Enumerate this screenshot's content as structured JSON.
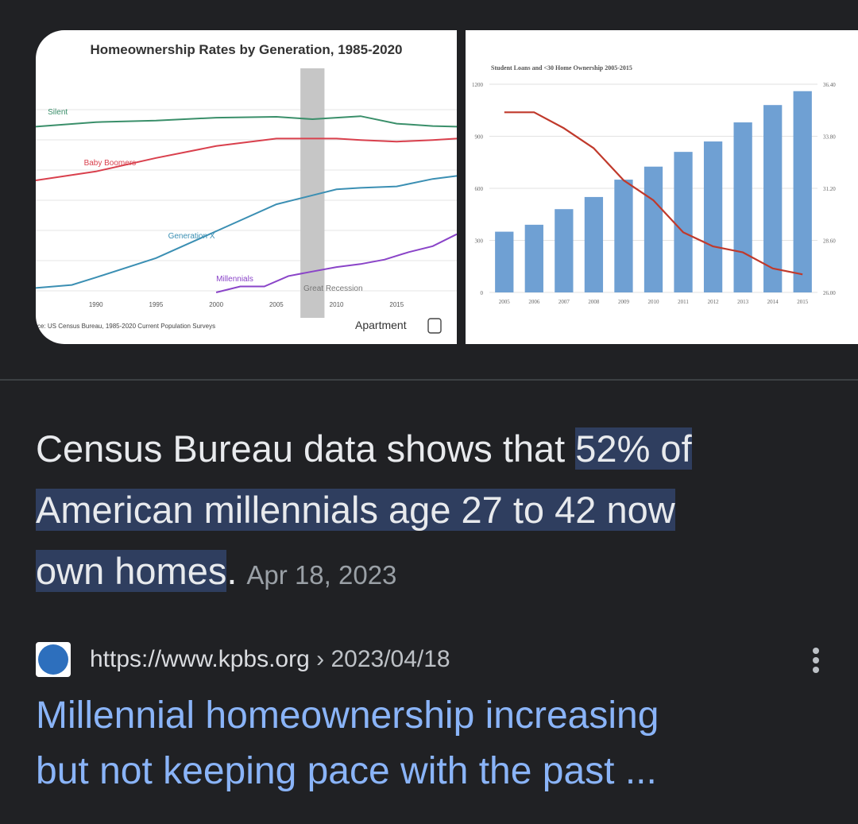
{
  "snippet": {
    "prefix": "Census Bureau data shows that ",
    "highlight_line1": "52% of",
    "highlight_line2": "American millennials age 27 to 42 now",
    "highlight_line3": "own homes",
    "suffix": ".",
    "date": "Apr 18, 2023"
  },
  "source": {
    "url": "https://www.kpbs.org",
    "separator": " › ",
    "path": "2023/04/18",
    "favicon_color": "#2d6fbd",
    "more_icon": "more-vert-icon"
  },
  "result": {
    "title_line1": "Millennial homeownership increasing",
    "title_line2": "but not keeping pace with the past ..."
  },
  "colors": {
    "background": "#202124",
    "link": "#8ab4f8",
    "highlight": "#2f3e5f",
    "muted": "#9aa0a6"
  },
  "chart_data": [
    {
      "type": "line",
      "title": "Homeownership Rates by Generation, 1985-2020",
      "x": [
        1985,
        1990,
        1995,
        2000,
        2005,
        2010,
        2015,
        2020
      ],
      "x_ticks": [
        "1990",
        "1995",
        "2000",
        "2005",
        "2010",
        "2015"
      ],
      "xlim": [
        1985,
        2020
      ],
      "series": [
        {
          "name": "Silent",
          "color": "#3a8f6a",
          "x": [
            1985,
            1990,
            1995,
            2000,
            2005,
            2008,
            2010,
            2012,
            2015,
            2018,
            2020
          ],
          "values": [
            79,
            80.5,
            81,
            82,
            82.3,
            81.5,
            82,
            82.5,
            80,
            79.2,
            79
          ]
        },
        {
          "name": "Baby Boomers",
          "color": "#d9404d",
          "x": [
            1985,
            1990,
            1995,
            2000,
            2005,
            2008,
            2010,
            2012,
            2015,
            2018,
            2020
          ],
          "values": [
            61,
            64,
            68.5,
            72.5,
            75,
            75,
            75,
            74.5,
            74,
            74.5,
            75
          ]
        },
        {
          "name": "Generation X",
          "color": "#3b8fb3",
          "x": [
            1985,
            1988,
            1990,
            1995,
            2000,
            2005,
            2008,
            2010,
            2012,
            2015,
            2018,
            2020
          ],
          "values": [
            25,
            26,
            28.5,
            35,
            44,
            53,
            56,
            58,
            58.5,
            59,
            61.5,
            62.5
          ]
        },
        {
          "name": "Millennials",
          "color": "#8a44c8",
          "x": [
            2000,
            2002,
            2004,
            2006,
            2008,
            2010,
            2012,
            2014,
            2016,
            2018,
            2020
          ],
          "values": [
            23.5,
            25.5,
            25.5,
            29,
            30.5,
            32,
            33,
            34.5,
            37,
            39,
            43
          ]
        }
      ],
      "ylim": [
        15,
        90
      ],
      "annotations": [
        {
          "text": "Great Recession",
          "x_start": 2007,
          "x_end": 2009,
          "shade": "#c6c6c6"
        }
      ],
      "source_note": "ce: US Census Bureau, 1985-2020 Current Population Surveys",
      "brand": "Apartment",
      "grid": true
    },
    {
      "type": "bar",
      "title": "Student Loans and <30 Home Ownership 2005-2015",
      "categories": [
        "2005",
        "2006",
        "2007",
        "2008",
        "2009",
        "2010",
        "2011",
        "2012",
        "2013",
        "2014",
        "2015"
      ],
      "series": [
        {
          "kind": "bar",
          "color": "#6fa0d3",
          "axis": "left",
          "values": [
            350,
            390,
            480,
            550,
            650,
            725,
            810,
            870,
            980,
            1080,
            1160
          ]
        },
        {
          "kind": "line",
          "color": "#c0392b",
          "axis": "right",
          "values": [
            35.0,
            35.0,
            34.2,
            33.2,
            31.6,
            30.6,
            29.0,
            28.3,
            28.0,
            27.2,
            26.9
          ]
        }
      ],
      "y_left_ticks": [
        "0",
        "300",
        "600",
        "900",
        "1200"
      ],
      "y_left_lim": [
        0,
        1200
      ],
      "y_right_ticks": [
        "26.00",
        "28.60",
        "31.20",
        "33.80",
        "36.40"
      ],
      "y_right_lim": [
        26,
        36.4
      ],
      "grid": true
    }
  ]
}
